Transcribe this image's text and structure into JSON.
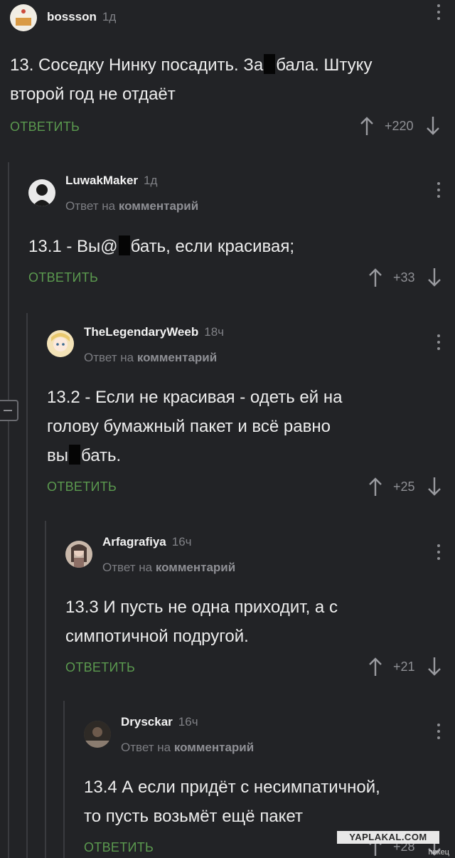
{
  "reply_label": "ОТВЕТИТЬ",
  "reply_to_prefix": "Ответ на",
  "reply_to_target": "комментарий",
  "colors": {
    "background": "#222326",
    "reply_green": "#5b9a4f",
    "muted": "#808186"
  },
  "comments": [
    {
      "username": "bossson",
      "time": "1д",
      "lines": [
        "13. Соседку Нинку посадить. За",
        "бала. Штуку",
        "второй год не отдаёт"
      ],
      "score": "+220",
      "avatar_icon": "cake-avatar-icon"
    },
    {
      "username": "LuwakMaker",
      "time": "1д",
      "lines": [
        "13.1 - Вы@",
        "бать, если красивая;"
      ],
      "score": "+33",
      "avatar_icon": "masked-figure-avatar-icon"
    },
    {
      "username": "TheLegendaryWeeb",
      "time": "18ч",
      "lines": [
        "13.2 - Если не красивая - одеть ей на",
        "голову бумажный пакет и всё равно",
        "вы",
        "бать."
      ],
      "score": "+25",
      "avatar_icon": "anime-girl-avatar-icon"
    },
    {
      "username": "Arfagrafiya",
      "time": "16ч",
      "lines": [
        "13.3 И пусть не одна приходит, а с",
        "симпотичной подругой."
      ],
      "score": "+21",
      "avatar_icon": "photo-avatar-icon"
    },
    {
      "username": "Drysckar",
      "time": "16ч",
      "lines": [
        "13.4 А если придёт с несимпатичной,",
        "то пусть возьмёт ещё пакет"
      ],
      "score": "+28",
      "avatar_icon": "dark-photo-avatar-icon"
    }
  ],
  "watermark": "YAPLAKAL.COM",
  "corner_mark": "пикец"
}
